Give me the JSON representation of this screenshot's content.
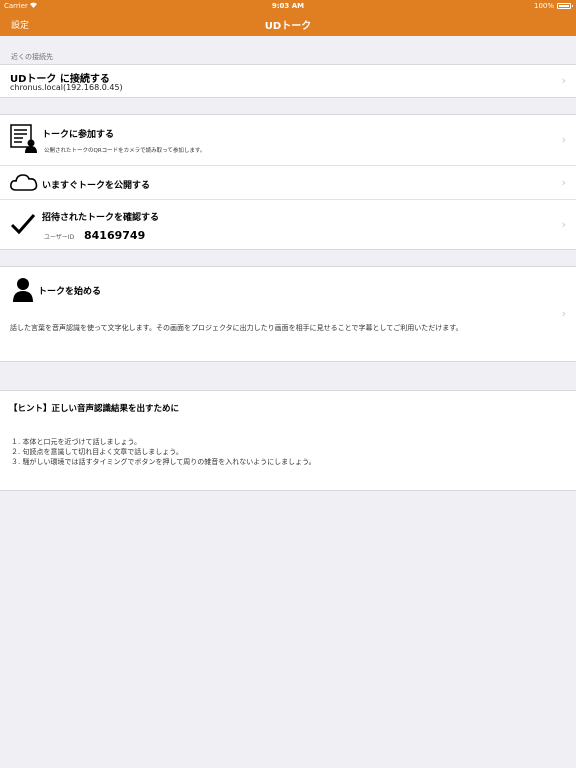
{
  "status": {
    "carrier": "Carrier",
    "time": "9:03 AM",
    "battery": "100%"
  },
  "nav": {
    "back": "設定",
    "title": "UDトーク"
  },
  "nearby": {
    "header": "近くの接続先",
    "title": "UDトーク に接続する",
    "host": "chronus.local(192.168.0.45)"
  },
  "menu": {
    "join_title": "トークに参加する",
    "join_sub": "公開されたトークのQRコードをカメラで読み取って参加します。",
    "publish_title": "いますぐトークを公開する",
    "invited_title": "招待されたトークを確認する",
    "user_id_label": "ユーザーID",
    "user_id": "84169749"
  },
  "start": {
    "title": "トークを始める",
    "description": "話した言葉を音声認識を使って文字化します。その画面をプロジェクタに出力したり画面を相手に見せることで字幕としてご利用いただけます。"
  },
  "hint": {
    "title": "【ヒント】正しい音声認識結果を出すために",
    "items": [
      "１. 本体と口元を近づけて話しましょう。",
      "２. 句読点を意識して切れ目よく文章で話しましょう。",
      "３. 騒がしい環境では話すタイミングでボタンを押して周りの雑音を入れないようにしましょう。"
    ]
  }
}
